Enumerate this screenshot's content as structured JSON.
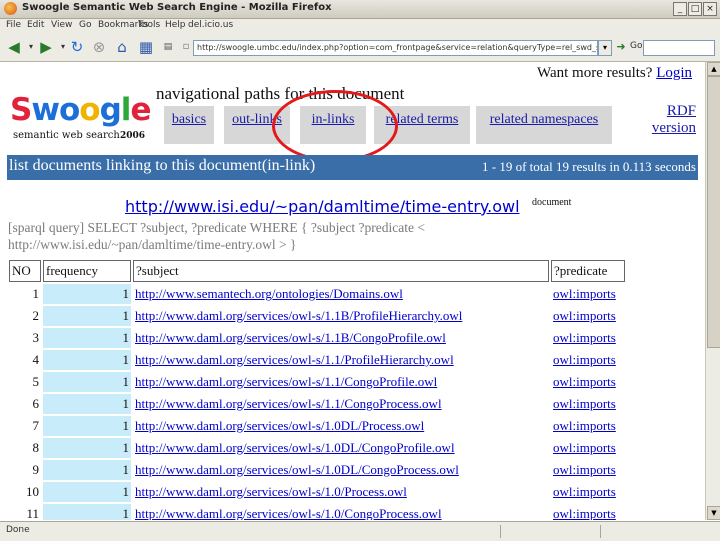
{
  "window": {
    "title": "Swoogle Semantic Web Search Engine - Mozilla Firefox"
  },
  "menu": [
    "File",
    "Edit",
    "View",
    "Go",
    "Bookmarks",
    "Tools",
    "Help",
    "del.icio.us"
  ],
  "navbar": {
    "url": "http://swoogle.umbc.edu/index.php?option=com_frontpage&service=relation&queryType=rel_swd_swt&searchString=http://www.isi.edu/~pan/damltime/time-entry.owl",
    "go_label": "Go"
  },
  "page": {
    "logo": {
      "s": "S",
      "w": "w",
      "o1": "o",
      "o2": "o",
      "g": "g",
      "l": "l",
      "e": "e"
    },
    "tagline": "semantic web search",
    "year": "2006",
    "nav_title": "navigational paths for this document",
    "more_results": "Want more results?",
    "login": "Login",
    "tabs": [
      "basics",
      "out-links",
      "in-links",
      "related terms",
      "related namespaces"
    ],
    "rdf_link": "RDF version",
    "section_title": "list documents linking to this document(in-link)",
    "result_summary": "1 - 19 of total 19 results in 0.113 seconds",
    "document_url": "http://www.isi.edu/~pan/damltime/time-entry.owl",
    "document_label": "document",
    "sparql": "[sparql query] SELECT ?subject, ?predicate WHERE { ?subject ?predicate < http://www.isi.edu/~pan/damltime/time-entry.owl > }",
    "columns": [
      "NO",
      "frequency",
      "?subject",
      "?predicate"
    ],
    "rows": [
      {
        "no": "1",
        "freq": "1",
        "subject": "http://www.semantech.org/ontologies/Domains.owl",
        "predicate": "owl:imports"
      },
      {
        "no": "2",
        "freq": "1",
        "subject": "http://www.daml.org/services/owl-s/1.1B/ProfileHierarchy.owl",
        "predicate": "owl:imports"
      },
      {
        "no": "3",
        "freq": "1",
        "subject": "http://www.daml.org/services/owl-s/1.1B/CongoProfile.owl",
        "predicate": "owl:imports"
      },
      {
        "no": "4",
        "freq": "1",
        "subject": "http://www.daml.org/services/owl-s/1.1/ProfileHierarchy.owl",
        "predicate": "owl:imports"
      },
      {
        "no": "5",
        "freq": "1",
        "subject": "http://www.daml.org/services/owl-s/1.1/CongoProfile.owl",
        "predicate": "owl:imports"
      },
      {
        "no": "6",
        "freq": "1",
        "subject": "http://www.daml.org/services/owl-s/1.1/CongoProcess.owl",
        "predicate": "owl:imports"
      },
      {
        "no": "7",
        "freq": "1",
        "subject": "http://www.daml.org/services/owl-s/1.0DL/Process.owl",
        "predicate": "owl:imports"
      },
      {
        "no": "8",
        "freq": "1",
        "subject": "http://www.daml.org/services/owl-s/1.0DL/CongoProfile.owl",
        "predicate": "owl:imports"
      },
      {
        "no": "9",
        "freq": "1",
        "subject": "http://www.daml.org/services/owl-s/1.0DL/CongoProcess.owl",
        "predicate": "owl:imports"
      },
      {
        "no": "10",
        "freq": "1",
        "subject": "http://www.daml.org/services/owl-s/1.0/Process.owl",
        "predicate": "owl:imports"
      },
      {
        "no": "11",
        "freq": "1",
        "subject": "http://www.daml.org/services/owl-s/1.0/CongoProcess.owl",
        "predicate": "owl:imports"
      }
    ]
  },
  "status": {
    "text": "Done"
  },
  "colors": {
    "tab_bg": "#d7d7d7",
    "bar_bg": "#3a6ea8",
    "freq_bg": "#c9ecfa",
    "highlight_circle": "#e21a1a",
    "link": "#0000cc"
  }
}
